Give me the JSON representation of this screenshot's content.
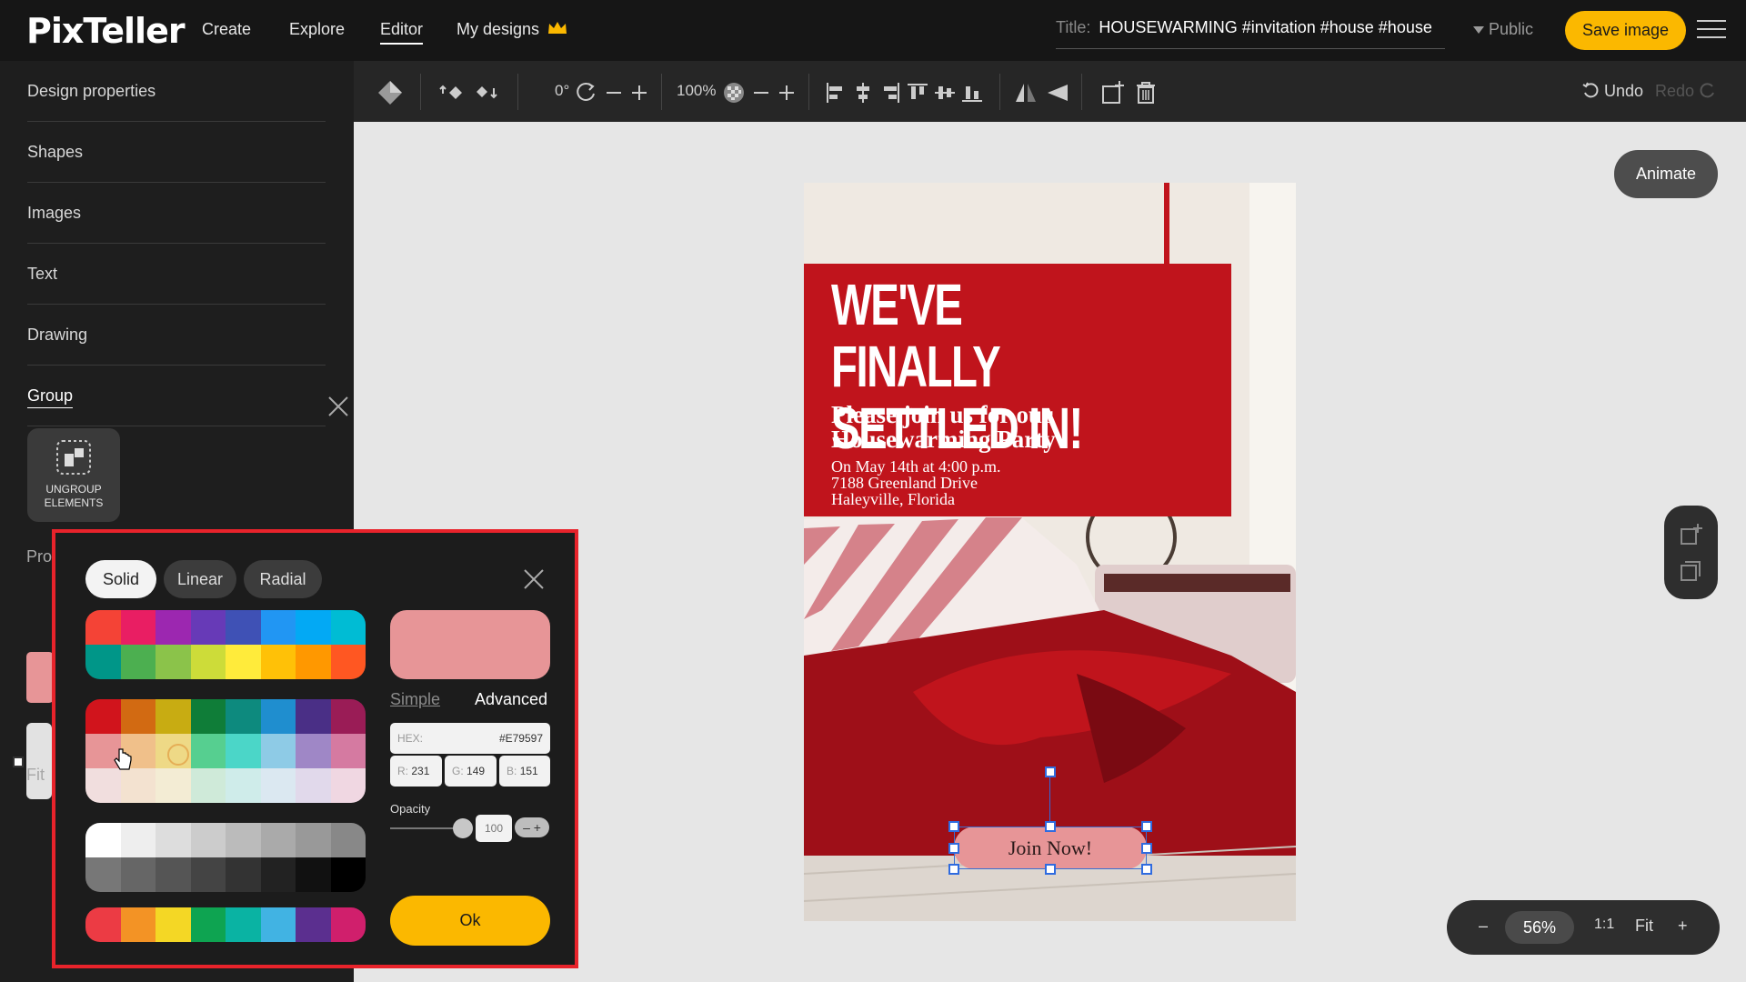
{
  "app": {
    "logo": "PixTeller",
    "nav": [
      "Create",
      "Explore",
      "Editor",
      "My designs"
    ],
    "title_label": "Title:",
    "title_value": "HOUSEWARMING #invitation #house #house",
    "visibility": "Public",
    "save_label": "Save image"
  },
  "sidebar": {
    "items": [
      "Design properties",
      "Shapes",
      "Images",
      "Text",
      "Drawing",
      "Group"
    ],
    "ungroup_label": "UNGROUP ELEMENTS",
    "partial_labels": [
      "Pro",
      "Fit"
    ]
  },
  "toolbar": {
    "rotation": "0°",
    "zoom": "100%",
    "undo": "Undo",
    "redo": "Redo"
  },
  "canvas": {
    "animate_label": "Animate",
    "zoom_value": "56%",
    "ratio": "1:1",
    "fit": "Fit",
    "zoom_minus": "–",
    "zoom_plus": "+"
  },
  "poster": {
    "headline_1": "WE'VE FINALLY",
    "headline_2": "SETTLED IN!",
    "sub_1": "Please join us for our",
    "sub_2": "Housewarming Party",
    "line_1": "On May 14th at 4:00 p.m.",
    "line_2": "7188 Greenland Drive",
    "line_3": "Haleyville, Florida",
    "button": "Join Now!",
    "accent_color": "#c0141c",
    "button_color": "#e79597"
  },
  "picker": {
    "tabs": [
      "Solid",
      "Linear",
      "Radial"
    ],
    "active_tab": "Solid",
    "mode_simple": "Simple",
    "mode_advanced": "Advanced",
    "hex_label": "HEX:",
    "hex_value": "#E79597",
    "r_label": "R:",
    "r_value": "231",
    "g_label": "G:",
    "g_value": "149",
    "b_label": "B:",
    "b_value": "151",
    "opacity_label": "Opacity",
    "opacity_value": "100",
    "ok_label": "Ok",
    "palette_material": [
      "#f44336",
      "#e91e63",
      "#9c27b0",
      "#673ab7",
      "#3f51b5",
      "#2196f3",
      "#03a9f4",
      "#00bcd4",
      "#009688",
      "#4caf50",
      "#8bc34a",
      "#cddc39",
      "#ffeb3b",
      "#ffc107",
      "#ff9800",
      "#ff5722"
    ],
    "palette_tones": [
      "#d1141c",
      "#d26a12",
      "#c8ac12",
      "#0f7d38",
      "#0d8a7e",
      "#1f8ecf",
      "#4a2f86",
      "#9a1c56",
      "#e79597",
      "#f0c08a",
      "#eed986",
      "#56cf90",
      "#4bd6c8",
      "#8ecbe6",
      "#9f87c6",
      "#d57aa1",
      "#f1dede",
      "#f3e2d0",
      "#f3ecd4",
      "#cfead9",
      "#cfecea",
      "#dbe8f1",
      "#e1d9eb",
      "#f0d7e2"
    ],
    "palette_grays": [
      "#ffffff",
      "#eeeeee",
      "#dddddd",
      "#cccccc",
      "#bbbbbb",
      "#aaaaaa",
      "#999999",
      "#888888",
      "#777777",
      "#666666",
      "#555555",
      "#444444",
      "#333333",
      "#222222",
      "#111111",
      "#000000"
    ],
    "palette_brand": [
      "#ec3b44",
      "#f39325",
      "#f4d725",
      "#0ea451",
      "#0ab3a3",
      "#41b3e3",
      "#5b2f8f",
      "#d01f6c"
    ]
  }
}
